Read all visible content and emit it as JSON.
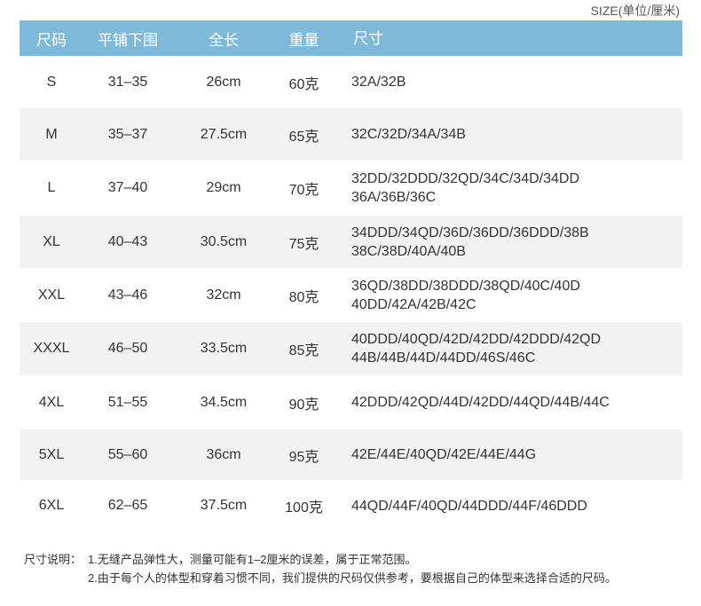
{
  "size_unit": "SIZE(单位/厘米)",
  "headers": [
    "尺码",
    "平铺下围",
    "全长",
    "重量",
    "尺寸"
  ],
  "rows": [
    {
      "size": "S",
      "band": "31–35",
      "length": "26cm",
      "weight": "60克",
      "fit1": "32A/32B",
      "fit2": ""
    },
    {
      "size": "M",
      "band": "35–37",
      "length": "27.5cm",
      "weight": "65克",
      "fit1": "32C/32D/34A/34B",
      "fit2": ""
    },
    {
      "size": "L",
      "band": "37–40",
      "length": "29cm",
      "weight": "70克",
      "fit1": "32DD/32DDD/32QD/34C/34D/34DD",
      "fit2": "36A/36B/36C"
    },
    {
      "size": "XL",
      "band": "40–43",
      "length": "30.5cm",
      "weight": "75克",
      "fit1": "34DDD/34QD/36D/36DD/36DDD/38B",
      "fit2": "38C/38D/40A/40B"
    },
    {
      "size": "XXL",
      "band": "43–46",
      "length": "32cm",
      "weight": "80克",
      "fit1": "36QD/38DD/38DDD/38QD/40C/40D",
      "fit2": "40DD/42A/42B/42C"
    },
    {
      "size": "XXXL",
      "band": "46–50",
      "length": "33.5cm",
      "weight": "85克",
      "fit1": "40DDD/40QD/42D/42DD/42DDD/42QD",
      "fit2": "44B/44B/44D/44DD/46S/46C"
    },
    {
      "size": "4XL",
      "band": "51–55",
      "length": "34.5cm",
      "weight": "90克",
      "fit1": "42DDD/42QD/44D/42DD/44QD/44B/44C",
      "fit2": ""
    },
    {
      "size": "5XL",
      "band": "55–60",
      "length": "36cm",
      "weight": "95克",
      "fit1": "42E/44E/40QD/42E/44E/44G",
      "fit2": ""
    },
    {
      "size": "6XL",
      "band": "62–65",
      "length": "37.5cm",
      "weight": "100克",
      "fit1": "44QD/44F/40QD/44DDD/44F/46DDD",
      "fit2": ""
    }
  ],
  "notes": {
    "label": "尺寸说明：",
    "line1": "1.无缝产品弹性大，测量可能有1–2厘米的误差，属于正常范围。",
    "line2": "2.由于每个人的体型和穿着习惯不同，我们提供的尺码仅供参考，要根据自己的体型来选择合适的尺码。"
  },
  "colors": {
    "header_bg": "#7fb9d9",
    "alt_row_bg": "#f2f2f2"
  }
}
